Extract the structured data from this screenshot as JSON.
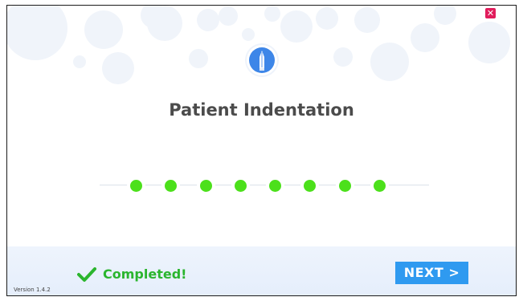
{
  "window": {
    "close_icon": "close-icon",
    "logo_icon": "pen-tip-icon"
  },
  "page": {
    "title": "Patient Indentation"
  },
  "progress": {
    "total_steps": 8,
    "completed_steps": 8,
    "step_color": "#4ce01b"
  },
  "footer": {
    "status_icon": "checkmark-icon",
    "status_text": "Completed!",
    "status_color": "#2bb52e",
    "next_label": "NEXT >",
    "next_color": "#2f9af0",
    "version": "Version 1.4.2"
  },
  "colors": {
    "accent": "#2f9af0",
    "close": "#e11d5c"
  }
}
